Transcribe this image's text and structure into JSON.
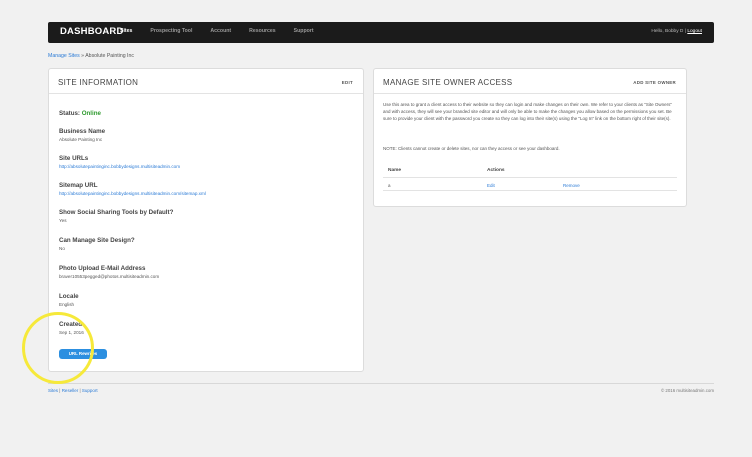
{
  "header": {
    "brand": "DASHBOARD",
    "nav": [
      "Sites",
      "Prospecting Tool",
      "Account",
      "Resources",
      "Support"
    ],
    "greeting": "Hello, Bobby D |",
    "logout": "Logout"
  },
  "breadcrumb": {
    "link": "Manage Sites",
    "separator": " » ",
    "current": "Absolute Painting Inc"
  },
  "site_info": {
    "title": "SITE INFORMATION",
    "edit_label": "EDIT",
    "status_label": "Status:",
    "status_value": "Online",
    "fields": [
      {
        "label": "Business Name",
        "value": "Absolute Painting Inc"
      },
      {
        "label": "Site URLs",
        "value": "http://absolutepaintinginc.bobbydesigns.multisiteadmin.com"
      },
      {
        "label": "Sitemap URL",
        "value": "http://absolutepaintinginc.bobbydesigns.multisiteadmin.com/sitemap.xml"
      },
      {
        "label": "Show Social Sharing Tools by Default?",
        "value": "Yes"
      },
      {
        "label": "Can Manage Site Design?",
        "value": "No"
      },
      {
        "label": "Photo Upload E-Mail Address",
        "value": "braver10553pegged@photos.multisiteadmin.com"
      },
      {
        "label": "Locale",
        "value": "English"
      },
      {
        "label": "Created",
        "value": "Sep 1, 2016"
      }
    ],
    "rewrite_button": "URL Rewrites"
  },
  "owner_access": {
    "title": "MANAGE SITE OWNER ACCESS",
    "add_label": "ADD SITE OWNER",
    "description": "Use this area to grant a client access to their website so they can login and make changes on their own. We refer to your clients as \"Site Owners\" and with access, they will see your branded site editor and will only be able to make the changes you allow based on the permissions you set. Be sure to provide your client with the password you create so they can log into their site(s) using the \"Log In\" link on the bottom right of their site(s).",
    "note": "NOTE: Clients cannot create or delete sites, nor can they access or see your dashboard.",
    "columns": [
      "Name",
      "Actions"
    ],
    "rows": [
      {
        "name": "a",
        "edit": "Edit",
        "remove": "Remove"
      }
    ]
  },
  "footer": {
    "links": [
      "Sites",
      "Reseller",
      "Support"
    ],
    "copyright": "© 2016 multisiteadmin.com"
  },
  "colors": {
    "topbar": "#1b1b1b",
    "link": "#2b7bd6",
    "online": "#2e9a2e",
    "button": "#2c8fe0",
    "highlight": "#f6e93a"
  }
}
